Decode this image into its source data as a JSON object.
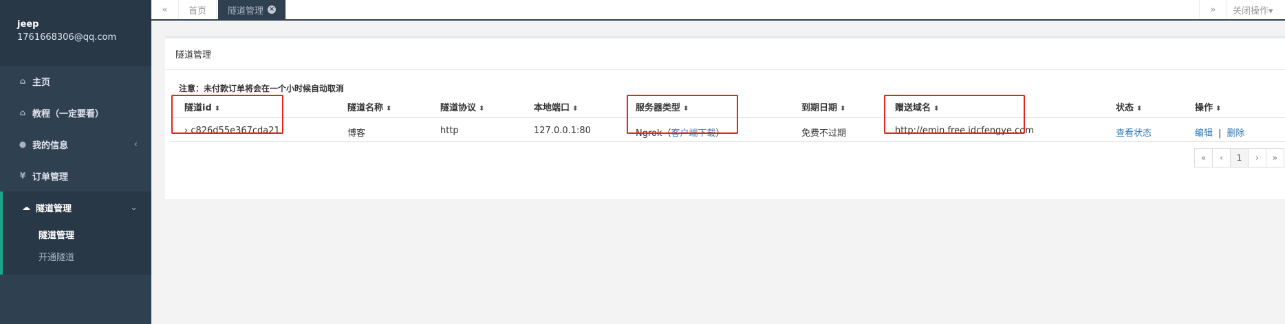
{
  "sidebar": {
    "user_name": "jeep",
    "user_email": "1761668306@qq.com",
    "items": [
      {
        "label": "主页",
        "icon": "home-icon",
        "glyph": "⌂"
      },
      {
        "label": "教程（一定要看）",
        "icon": "home-icon",
        "glyph": "⌂"
      },
      {
        "label": "我的信息",
        "icon": "user-icon",
        "glyph": "●",
        "chevron": "‹"
      },
      {
        "label": "订单管理",
        "icon": "yen-icon",
        "glyph": "¥"
      },
      {
        "label": "隧道管理",
        "icon": "cloud-icon",
        "glyph": "☁",
        "chevron": "⌄"
      }
    ],
    "sub_items": [
      {
        "label": "隧道管理"
      },
      {
        "label": "开通隧道"
      }
    ]
  },
  "tabbar": {
    "prev_glyph": "«",
    "tabs": [
      {
        "label": "首页"
      },
      {
        "label": "隧道管理",
        "close_glyph": "×"
      }
    ],
    "next_glyph": "»",
    "close_ops_label": "关闭操作▾"
  },
  "panel": {
    "title": "隧道管理",
    "notice": "注意：未付款订单将会在一个小时候自动取消",
    "sort_glyph": "⬍",
    "columns": [
      "隧道id",
      "隧道名称",
      "隧道协议",
      "本地端口",
      "服务器类型",
      "到期日期",
      "赠送域名",
      "状态",
      "操作"
    ],
    "row": {
      "expand_glyph": "›",
      "id": "c826d55e367cda21",
      "name": "博客",
      "protocol": "http",
      "local_port": "127.0.0.1:80",
      "server_type_prefix": "Ngrok（",
      "server_type_link": "客户端下载",
      "server_type_suffix": "）",
      "expire": "免费不过期",
      "domain": "http://emin.free.idcfengye.com",
      "status_link": "查看状态",
      "edit_link": "编辑",
      "separator": "|",
      "delete_link": "删除"
    },
    "pager": [
      "«",
      "‹",
      "1",
      "›",
      "»"
    ],
    "current_page": "1"
  },
  "colors": {
    "sidebar_bg": "#2f4050",
    "accent": "#19aa8d",
    "highlight_box": "#e5231f",
    "link": "#337ab7"
  }
}
